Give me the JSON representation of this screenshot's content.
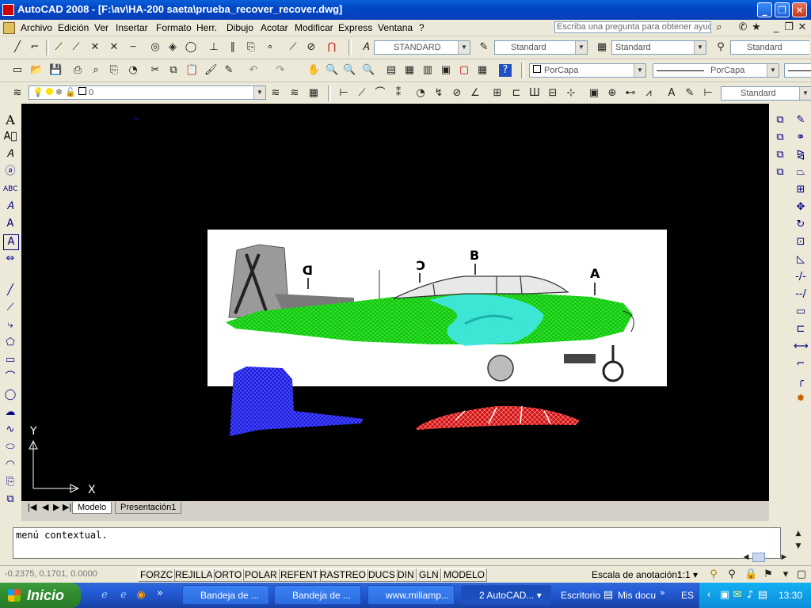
{
  "window": {
    "title": "AutoCAD 2008 - [F:\\av\\HA-200 saeta\\prueba_recover_recover.dwg]"
  },
  "menu": {
    "items": [
      "Archivo",
      "Edición",
      "Ver",
      "Insertar",
      "Formato",
      "Herr.",
      "Dibujo",
      "Acotar",
      "Modificar",
      "Express",
      "Ventana",
      "?"
    ],
    "ask_placeholder": "Escriba una pregunta para obtener ayuda"
  },
  "toolbars": {
    "text_style": "STANDARD",
    "dim_style": "Standard",
    "table_style": "Standard",
    "mleader_style": "Standard",
    "color": "PorCapa",
    "linetype": "PorCapa",
    "layer": "0",
    "dim_style_2": "Standard"
  },
  "drawing": {
    "labels": [
      "A",
      "B",
      "C",
      "D"
    ],
    "ucs_x": "X",
    "ucs_y": "Y",
    "colors": {
      "background": "#000000",
      "fuselage_mesh": "#22e61e",
      "canopy_mesh": "#40e8e8",
      "tail_mesh": "#1a1ae0",
      "canopy_part_mesh": "#e01010"
    }
  },
  "layout_tabs": [
    "Modelo",
    "Presentación1"
  ],
  "command": {
    "line1": "menú contextual."
  },
  "status": {
    "coordinates": "-0.2375, 0.1701, 0.0000",
    "toggles": [
      "FORZC",
      "REJILLA",
      "ORTO",
      "POLAR",
      "REFENT",
      "RASTREO",
      "DUCS",
      "DIN",
      "GLN",
      "MODELO"
    ],
    "annotation_scale_label": "Escala de anotación:",
    "annotation_scale_value": "1:1"
  },
  "taskbar": {
    "start_label": "Inicio",
    "tasks": [
      "Bandeja de ...",
      "Bandeja de ...",
      "www.miliamp...",
      "2 AutoCAD..."
    ],
    "desktop_label": "Escritorio",
    "docs_label": "Mis docu",
    "lang": "ES",
    "clock": "13:30"
  }
}
